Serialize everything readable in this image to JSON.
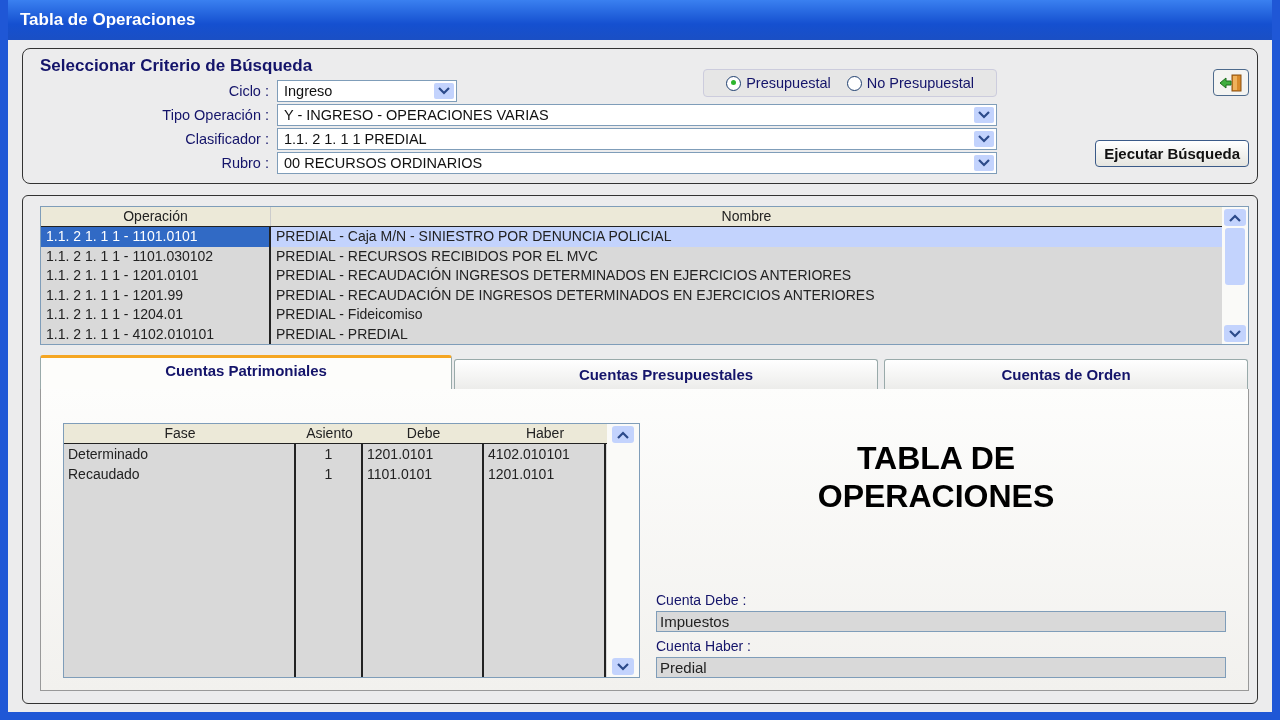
{
  "window": {
    "title": "Tabla de Operaciones"
  },
  "search": {
    "title": "Seleccionar Criterio de Búsqueda",
    "fields": [
      {
        "label": "Ciclo :",
        "value": "Ingreso",
        "kind": "short"
      },
      {
        "label": "Tipo Operación :",
        "value": "Y  - INGRESO - OPERACIONES VARIAS",
        "kind": "long"
      },
      {
        "label": "Clasificador :",
        "value": "1.1. 2 1. 1 1 PREDIAL",
        "kind": "long"
      },
      {
        "label": "Rubro :",
        "value": "00 RECURSOS ORDINARIOS",
        "kind": "long"
      }
    ],
    "radios": [
      {
        "label": "Presupuestal",
        "selected": true
      },
      {
        "label": "No Presupuestal",
        "selected": false
      }
    ],
    "button": "Ejecutar Búsqueda"
  },
  "operations": {
    "columns": [
      "Operación",
      "Nombre"
    ],
    "rows": [
      {
        "operacion": "1.1. 2 1. 1 1 - 1101.0101",
        "nombre": "PREDIAL - Caja M/N - SINIESTRO POR DENUNCIA POLICIAL",
        "selected": true
      },
      {
        "operacion": "1.1. 2 1. 1 1 - 1101.030102",
        "nombre": "PREDIAL - RECURSOS RECIBIDOS POR EL MVC",
        "selected": false
      },
      {
        "operacion": "1.1. 2 1. 1 1 - 1201.0101",
        "nombre": "PREDIAL - RECAUDACIÓN INGRESOS DETERMINADOS EN EJERCICIOS ANTERIORES",
        "selected": false
      },
      {
        "operacion": "1.1. 2 1. 1 1 - 1201.99",
        "nombre": "PREDIAL - RECAUDACIÓN DE INGRESOS DETERMINADOS EN EJERCICIOS ANTERIORES",
        "selected": false
      },
      {
        "operacion": "1.1. 2 1. 1 1 - 1204.01",
        "nombre": "PREDIAL - Fideicomiso",
        "selected": false
      },
      {
        "operacion": "1.1. 2 1. 1 1 - 4102.010101",
        "nombre": "PREDIAL - PREDIAL",
        "selected": false
      }
    ]
  },
  "tabs": [
    {
      "label": "Cuentas Patrimoniales",
      "selected": true
    },
    {
      "label": "Cuentas Presupuestales",
      "selected": false
    },
    {
      "label": "Cuentas de Orden",
      "selected": false
    }
  ],
  "detail": {
    "columns": [
      "Fase",
      "Asiento",
      "Debe",
      "Haber"
    ],
    "rows": [
      [
        "Determinado",
        "1",
        "1201.0101",
        "4102.010101"
      ],
      [
        "Recaudado",
        "1",
        "1101.0101",
        "1201.0101"
      ]
    ]
  },
  "overlay_lines": [
    "TABLA DE",
    "OPERACIONES"
  ],
  "accounts": [
    {
      "label": "Cuenta Debe :",
      "value": "Impuestos"
    },
    {
      "label": "Cuenta Haber :",
      "value": "Predial"
    }
  ]
}
